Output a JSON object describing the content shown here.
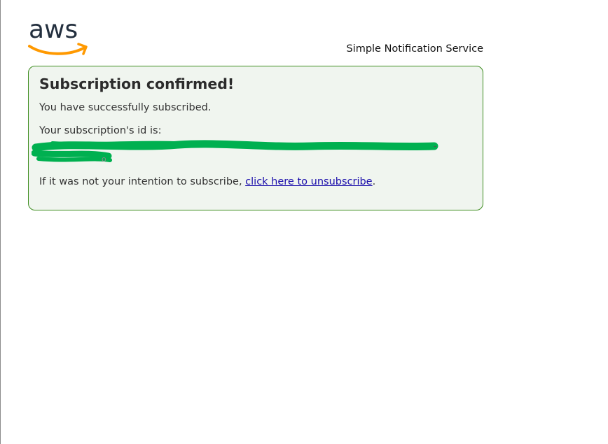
{
  "brand": {
    "logo_text": "aws",
    "logo_text_color": "#232f3e",
    "smile_color": "#f90"
  },
  "header": {
    "service_name": "Simple Notification Service"
  },
  "panel": {
    "title": "Subscription confirmed!",
    "success_message": "You have successfully subscribed.",
    "id_label": "Your subscription's id is:",
    "id_value_state": "redacted",
    "unsubscribe_prefix": "If it was not your intention to subscribe, ",
    "unsubscribe_link": "click here to unsubscribe",
    "unsubscribe_suffix": ".",
    "border_color": "#3c8c1e",
    "background_color": "#f0f5ef",
    "redaction_color": "#00b050"
  }
}
